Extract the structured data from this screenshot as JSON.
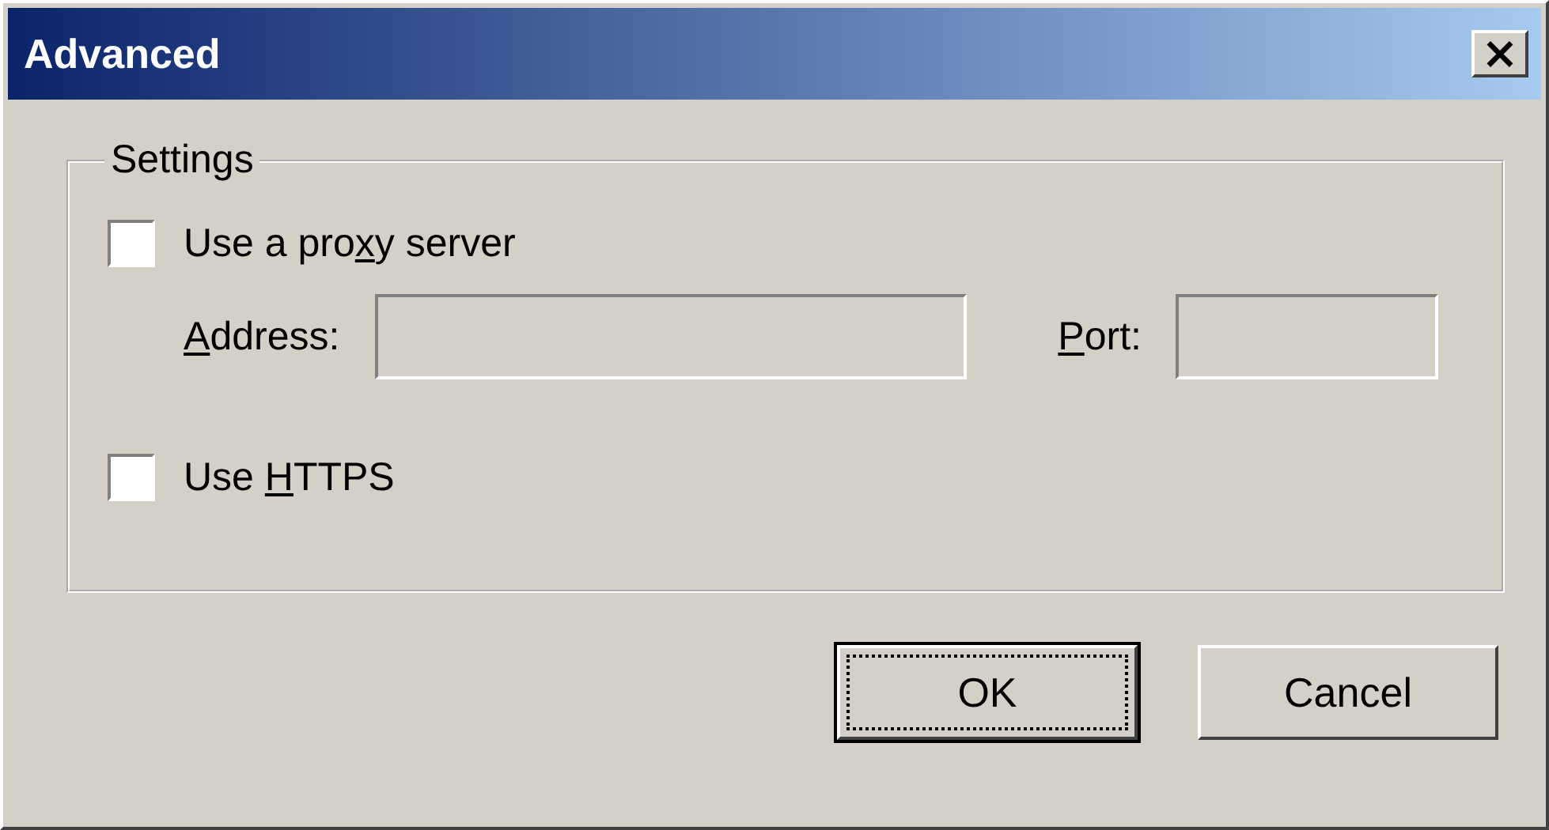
{
  "window": {
    "title": "Advanced",
    "close": "×"
  },
  "group": {
    "title": "Settings",
    "items": [
      {
        "kind": "checkbox",
        "checked": false,
        "label": {
          "before": "Use a pro",
          "key": "x",
          "after": "y server"
        }
      },
      {
        "kind": "fields",
        "fields": [
          {
            "label": {
              "key": "A",
              "after": "ddress:"
            },
            "disabled": true
          },
          {
            "label": {
              "key": "P",
              "after": "ort:"
            },
            "disabled": true
          }
        ]
      },
      {
        "kind": "checkbox",
        "checked": false,
        "label": {
          "before": "Use ",
          "key": "H",
          "after": "TTPS"
        }
      }
    ]
  },
  "buttons": [
    {
      "label": "OK",
      "default": true,
      "focused": true
    },
    {
      "label": "Cancel",
      "default": false,
      "focused": false
    }
  ]
}
